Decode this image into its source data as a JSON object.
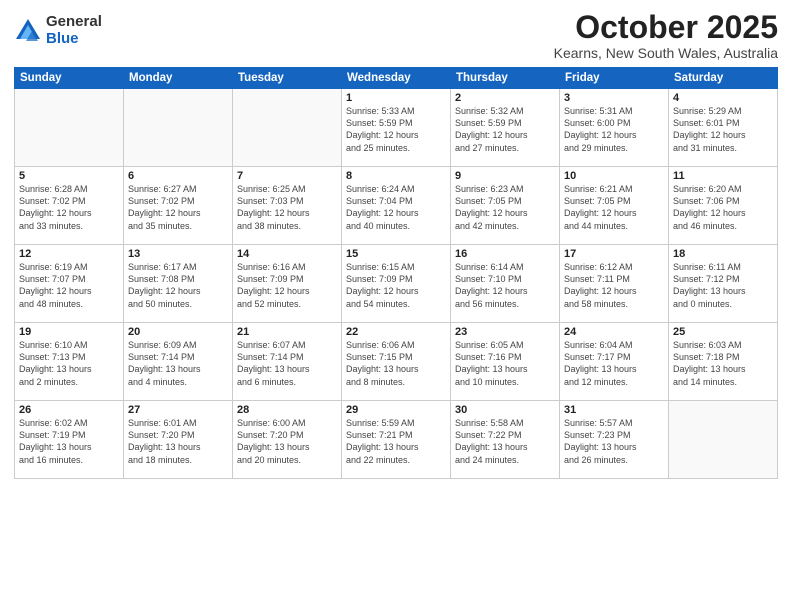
{
  "logo": {
    "general": "General",
    "blue": "Blue"
  },
  "title": "October 2025",
  "subtitle": "Kearns, New South Wales, Australia",
  "days_header": [
    "Sunday",
    "Monday",
    "Tuesday",
    "Wednesday",
    "Thursday",
    "Friday",
    "Saturday"
  ],
  "weeks": [
    [
      {
        "day": "",
        "info": ""
      },
      {
        "day": "",
        "info": ""
      },
      {
        "day": "",
        "info": ""
      },
      {
        "day": "1",
        "info": "Sunrise: 5:33 AM\nSunset: 5:59 PM\nDaylight: 12 hours\nand 25 minutes."
      },
      {
        "day": "2",
        "info": "Sunrise: 5:32 AM\nSunset: 5:59 PM\nDaylight: 12 hours\nand 27 minutes."
      },
      {
        "day": "3",
        "info": "Sunrise: 5:31 AM\nSunset: 6:00 PM\nDaylight: 12 hours\nand 29 minutes."
      },
      {
        "day": "4",
        "info": "Sunrise: 5:29 AM\nSunset: 6:01 PM\nDaylight: 12 hours\nand 31 minutes."
      }
    ],
    [
      {
        "day": "5",
        "info": "Sunrise: 6:28 AM\nSunset: 7:02 PM\nDaylight: 12 hours\nand 33 minutes."
      },
      {
        "day": "6",
        "info": "Sunrise: 6:27 AM\nSunset: 7:02 PM\nDaylight: 12 hours\nand 35 minutes."
      },
      {
        "day": "7",
        "info": "Sunrise: 6:25 AM\nSunset: 7:03 PM\nDaylight: 12 hours\nand 38 minutes."
      },
      {
        "day": "8",
        "info": "Sunrise: 6:24 AM\nSunset: 7:04 PM\nDaylight: 12 hours\nand 40 minutes."
      },
      {
        "day": "9",
        "info": "Sunrise: 6:23 AM\nSunset: 7:05 PM\nDaylight: 12 hours\nand 42 minutes."
      },
      {
        "day": "10",
        "info": "Sunrise: 6:21 AM\nSunset: 7:05 PM\nDaylight: 12 hours\nand 44 minutes."
      },
      {
        "day": "11",
        "info": "Sunrise: 6:20 AM\nSunset: 7:06 PM\nDaylight: 12 hours\nand 46 minutes."
      }
    ],
    [
      {
        "day": "12",
        "info": "Sunrise: 6:19 AM\nSunset: 7:07 PM\nDaylight: 12 hours\nand 48 minutes."
      },
      {
        "day": "13",
        "info": "Sunrise: 6:17 AM\nSunset: 7:08 PM\nDaylight: 12 hours\nand 50 minutes."
      },
      {
        "day": "14",
        "info": "Sunrise: 6:16 AM\nSunset: 7:09 PM\nDaylight: 12 hours\nand 52 minutes."
      },
      {
        "day": "15",
        "info": "Sunrise: 6:15 AM\nSunset: 7:09 PM\nDaylight: 12 hours\nand 54 minutes."
      },
      {
        "day": "16",
        "info": "Sunrise: 6:14 AM\nSunset: 7:10 PM\nDaylight: 12 hours\nand 56 minutes."
      },
      {
        "day": "17",
        "info": "Sunrise: 6:12 AM\nSunset: 7:11 PM\nDaylight: 12 hours\nand 58 minutes."
      },
      {
        "day": "18",
        "info": "Sunrise: 6:11 AM\nSunset: 7:12 PM\nDaylight: 13 hours\nand 0 minutes."
      }
    ],
    [
      {
        "day": "19",
        "info": "Sunrise: 6:10 AM\nSunset: 7:13 PM\nDaylight: 13 hours\nand 2 minutes."
      },
      {
        "day": "20",
        "info": "Sunrise: 6:09 AM\nSunset: 7:14 PM\nDaylight: 13 hours\nand 4 minutes."
      },
      {
        "day": "21",
        "info": "Sunrise: 6:07 AM\nSunset: 7:14 PM\nDaylight: 13 hours\nand 6 minutes."
      },
      {
        "day": "22",
        "info": "Sunrise: 6:06 AM\nSunset: 7:15 PM\nDaylight: 13 hours\nand 8 minutes."
      },
      {
        "day": "23",
        "info": "Sunrise: 6:05 AM\nSunset: 7:16 PM\nDaylight: 13 hours\nand 10 minutes."
      },
      {
        "day": "24",
        "info": "Sunrise: 6:04 AM\nSunset: 7:17 PM\nDaylight: 13 hours\nand 12 minutes."
      },
      {
        "day": "25",
        "info": "Sunrise: 6:03 AM\nSunset: 7:18 PM\nDaylight: 13 hours\nand 14 minutes."
      }
    ],
    [
      {
        "day": "26",
        "info": "Sunrise: 6:02 AM\nSunset: 7:19 PM\nDaylight: 13 hours\nand 16 minutes."
      },
      {
        "day": "27",
        "info": "Sunrise: 6:01 AM\nSunset: 7:20 PM\nDaylight: 13 hours\nand 18 minutes."
      },
      {
        "day": "28",
        "info": "Sunrise: 6:00 AM\nSunset: 7:20 PM\nDaylight: 13 hours\nand 20 minutes."
      },
      {
        "day": "29",
        "info": "Sunrise: 5:59 AM\nSunset: 7:21 PM\nDaylight: 13 hours\nand 22 minutes."
      },
      {
        "day": "30",
        "info": "Sunrise: 5:58 AM\nSunset: 7:22 PM\nDaylight: 13 hours\nand 24 minutes."
      },
      {
        "day": "31",
        "info": "Sunrise: 5:57 AM\nSunset: 7:23 PM\nDaylight: 13 hours\nand 26 minutes."
      },
      {
        "day": "",
        "info": ""
      }
    ]
  ]
}
